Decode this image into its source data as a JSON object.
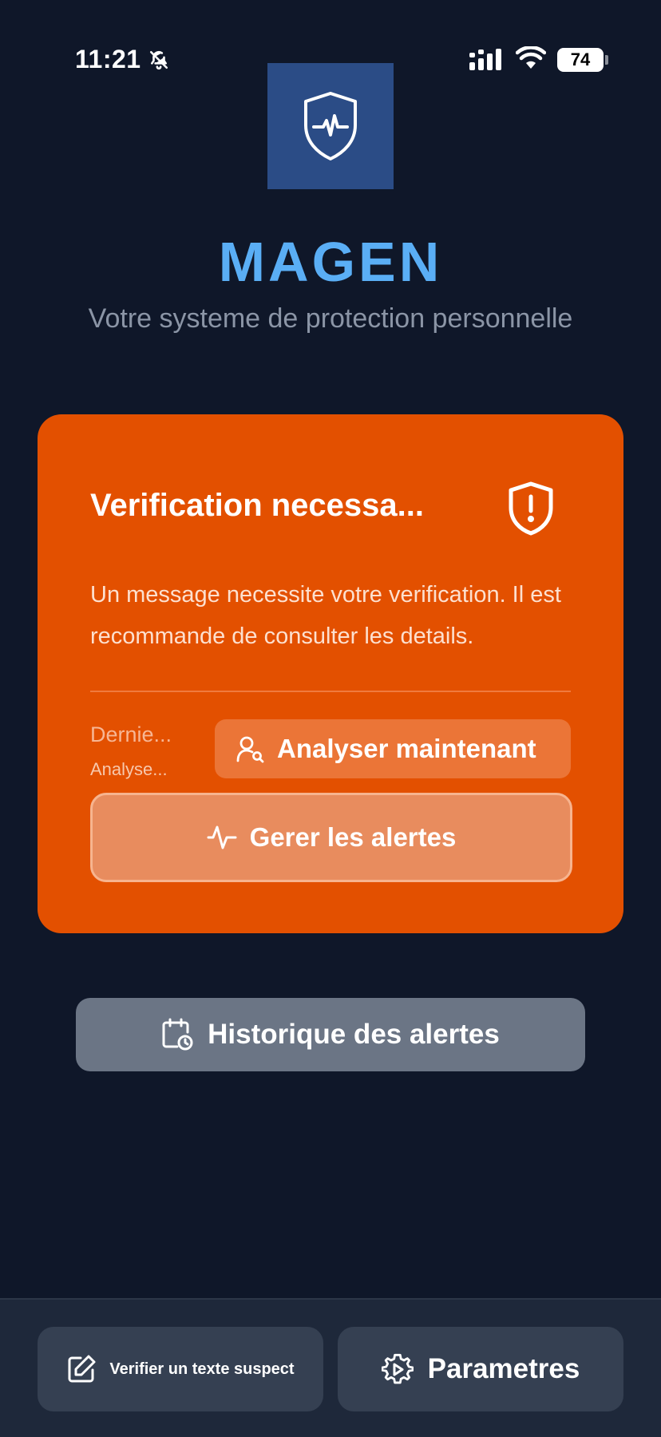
{
  "status_bar": {
    "time": "11:21",
    "battery": "74"
  },
  "header": {
    "app_name": "MAGEN",
    "tagline": "Votre systeme de protection personnelle"
  },
  "alert_card": {
    "title": "Verification necessa...",
    "message": "Un message necessite votre verification. Il est recommande de consulter les details.",
    "last_label": "Dernie...",
    "last_sub": "Analyse...",
    "analyze_label": "Analyser maintenant",
    "manage_label": "Gerer les alertes",
    "background_color": "#e35000"
  },
  "history": {
    "label": "Historique des alertes"
  },
  "bottom_bar": {
    "verify_label": "Verifier un texte suspect",
    "settings_label": "Parametres"
  },
  "colors": {
    "background": "#0f1729",
    "accent": "#5aaef5",
    "logo_bg": "#2b4c86"
  },
  "icons": {
    "status": [
      "bell-off-icon",
      "signal-icon",
      "wifi-icon",
      "battery-icon"
    ],
    "logo": "shield-heartbeat-icon",
    "card": "shield-alert-icon",
    "analyze": "user-search-icon",
    "manage": "activity-icon",
    "history": "calendar-clock-icon",
    "verify": "edit-icon",
    "settings": "gear-icon"
  }
}
